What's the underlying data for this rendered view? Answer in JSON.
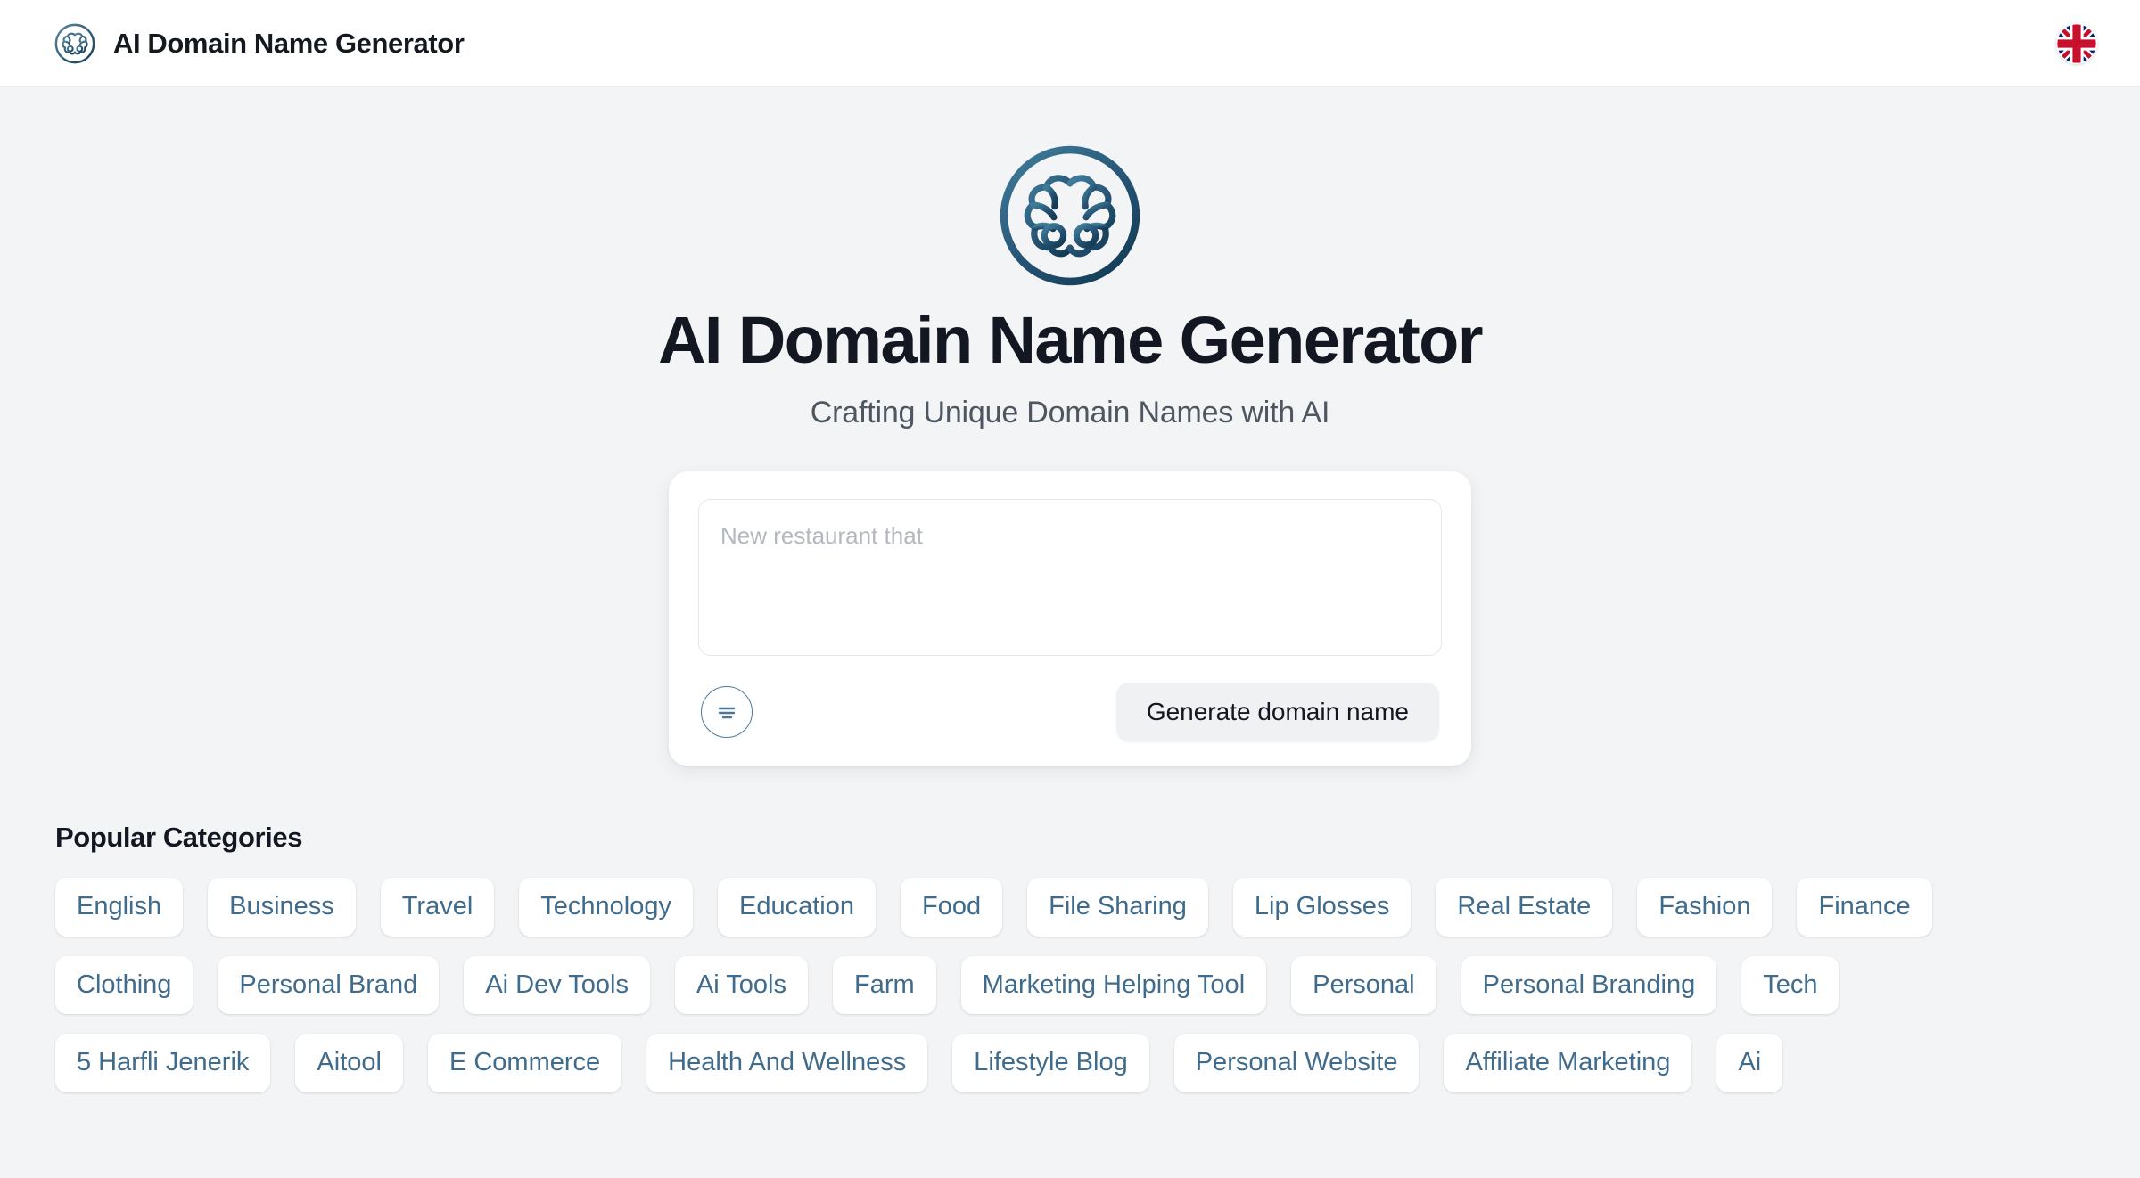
{
  "header": {
    "brand_title": "AI Domain Name Generator",
    "brand_icon": "brain-circle-icon",
    "language_icon": "uk-flag-icon",
    "language_label": "English"
  },
  "hero": {
    "logo_icon": "brain-circle-icon",
    "title": "AI Domain Name Generator",
    "subtitle": "Crafting Unique Domain Names with AI"
  },
  "prompt": {
    "placeholder": "New restaurant that",
    "value": "",
    "options_icon": "align-lines-icon",
    "generate_label": "Generate domain name"
  },
  "categories": {
    "heading": "Popular Categories",
    "rows": [
      [
        "English",
        "Business",
        "Travel",
        "Technology",
        "Education",
        "Food",
        "File Sharing",
        "Lip Glosses",
        "Real Estate",
        "Fashion",
        "Finance"
      ],
      [
        "Clothing",
        "Personal Brand",
        "Ai Dev Tools",
        "Ai Tools",
        "Farm",
        "Marketing Helping Tool",
        "Personal",
        "Personal Branding",
        "Tech"
      ],
      [
        "5 Harfli Jenerik",
        "Aitool",
        "E Commerce",
        "Health And Wellness",
        "Lifestyle Blog",
        "Personal Website",
        "Affiliate Marketing",
        "Ai"
      ]
    ]
  },
  "colors": {
    "page_background": "#f3f4f6",
    "header_background": "#ffffff",
    "brand_text": "#14181f",
    "accent_blue": "#3f6b8c",
    "logo_navy": "#1b4965",
    "muted_text": "#4d5661",
    "button_background": "#f0f1f3",
    "placeholder_text": "#b3b8c0"
  }
}
